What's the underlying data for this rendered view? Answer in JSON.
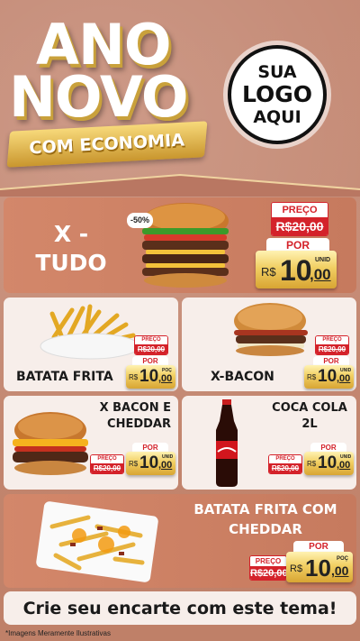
{
  "header": {
    "line1": "ANO",
    "line2": "NOVO",
    "banner": "COM ECONOMIA",
    "logo": [
      "SUA",
      "LOGO",
      "AQUI"
    ]
  },
  "colors": {
    "accent": "#d4222a",
    "gold": "#f1cf63",
    "panel_orange": "#cd8166",
    "panel_light": "#f7eeea"
  },
  "products": {
    "xtudo": {
      "name_1": "X -",
      "name_2": "TUDO",
      "discount": "-50%",
      "preco_label": "PREÇO",
      "old_price": "R$20,00",
      "por_label": "POR",
      "currency": "R$",
      "price_int": "10",
      "price_cents": ",00",
      "unit": "UNID"
    },
    "batata": {
      "name": "BATATA FRITA",
      "preco_label": "PREÇO",
      "old_price": "R$20,00",
      "por_label": "POR",
      "currency": "R$",
      "price_int": "10",
      "price_cents": ",00",
      "unit": "POÇ"
    },
    "xbacon": {
      "name": "X-BACON",
      "preco_label": "PREÇO",
      "old_price": "R$20,00",
      "por_label": "POR",
      "currency": "R$",
      "price_int": "10",
      "price_cents": ",00",
      "unit": "UNID"
    },
    "xbaconcheddar": {
      "name_1": "X BACON E",
      "name_2": "CHEDDAR",
      "preco_label": "PREÇO",
      "old_price": "R$20,00",
      "por_label": "POR",
      "currency": "R$",
      "price_int": "10",
      "price_cents": ",00",
      "unit": "UNID"
    },
    "coca": {
      "name_1": "COCA COLA",
      "name_2": "2L",
      "preco_label": "PREÇO",
      "old_price": "R$20,00",
      "por_label": "POR",
      "currency": "R$",
      "price_int": "10",
      "price_cents": ",00",
      "unit": "UNID"
    },
    "batatacheddar": {
      "name_1": "BATATA FRITA COM",
      "name_2": "CHEDDAR",
      "preco_label": "PREÇO",
      "old_price": "R$20,00",
      "por_label": "POR",
      "currency": "R$",
      "price_int": "10",
      "price_cents": ",00",
      "unit": "POÇ"
    }
  },
  "footer": {
    "cta": "Crie seu encarte com este tema!",
    "note": "*Imagens Meramente Ilustrativas"
  }
}
